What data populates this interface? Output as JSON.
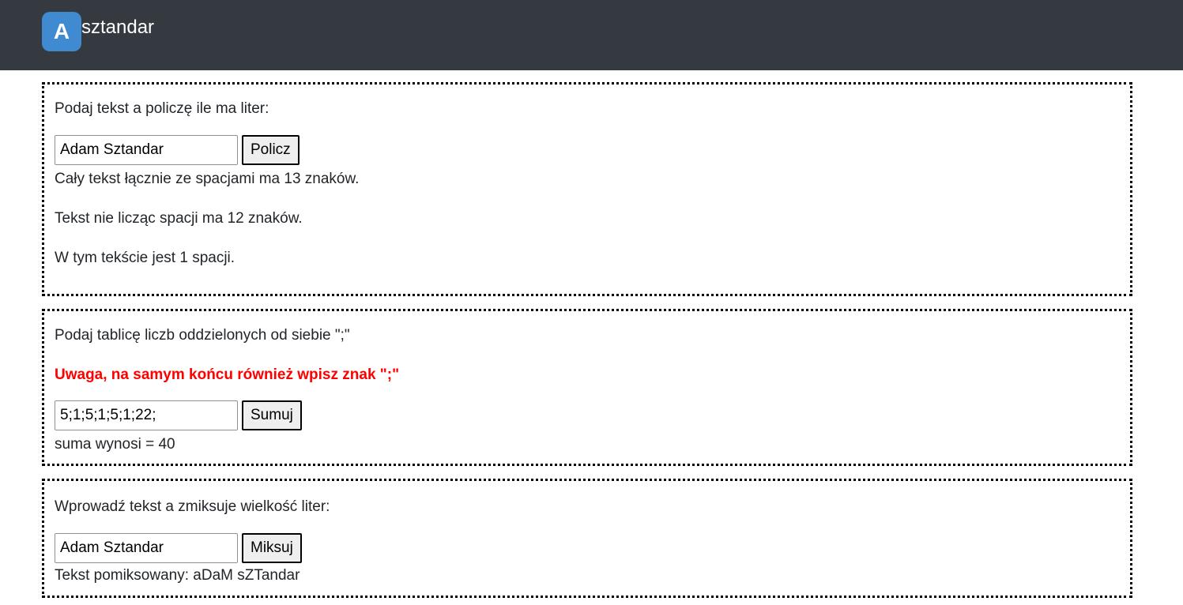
{
  "header": {
    "logo_letter": "A",
    "logo_text": "sztandar"
  },
  "section1": {
    "prompt": "Podaj tekst a policzę ile ma liter:",
    "input_value": "Adam Sztandar",
    "button_label": "Policz",
    "result_total": "Cały tekst łącznie ze spacjami ma 13 znaków.",
    "result_no_spaces": "Tekst nie licząc spacji ma 12 znaków.",
    "result_spaces": "W tym tekście jest 1 spacji."
  },
  "section2": {
    "prompt": "Podaj tablicę liczb oddzielonych od siebie \";\"",
    "warning": "Uwaga, na samym końcu również wpisz znak \";\"",
    "input_value": "5;1;5;1;5;1;22;",
    "button_label": "Sumuj",
    "result": "suma wynosi = 40"
  },
  "section3": {
    "prompt": "Wprowadź tekst a zmiksuje wielkość liter:",
    "input_value": "Adam Sztandar",
    "button_label": "Miksuj",
    "result": "Tekst pomiksowany: aDaM sZTandar"
  },
  "colors": {
    "navbar_bg": "#343a40",
    "logo_bg": "#3f8ad1",
    "warning": "#ff0000"
  }
}
